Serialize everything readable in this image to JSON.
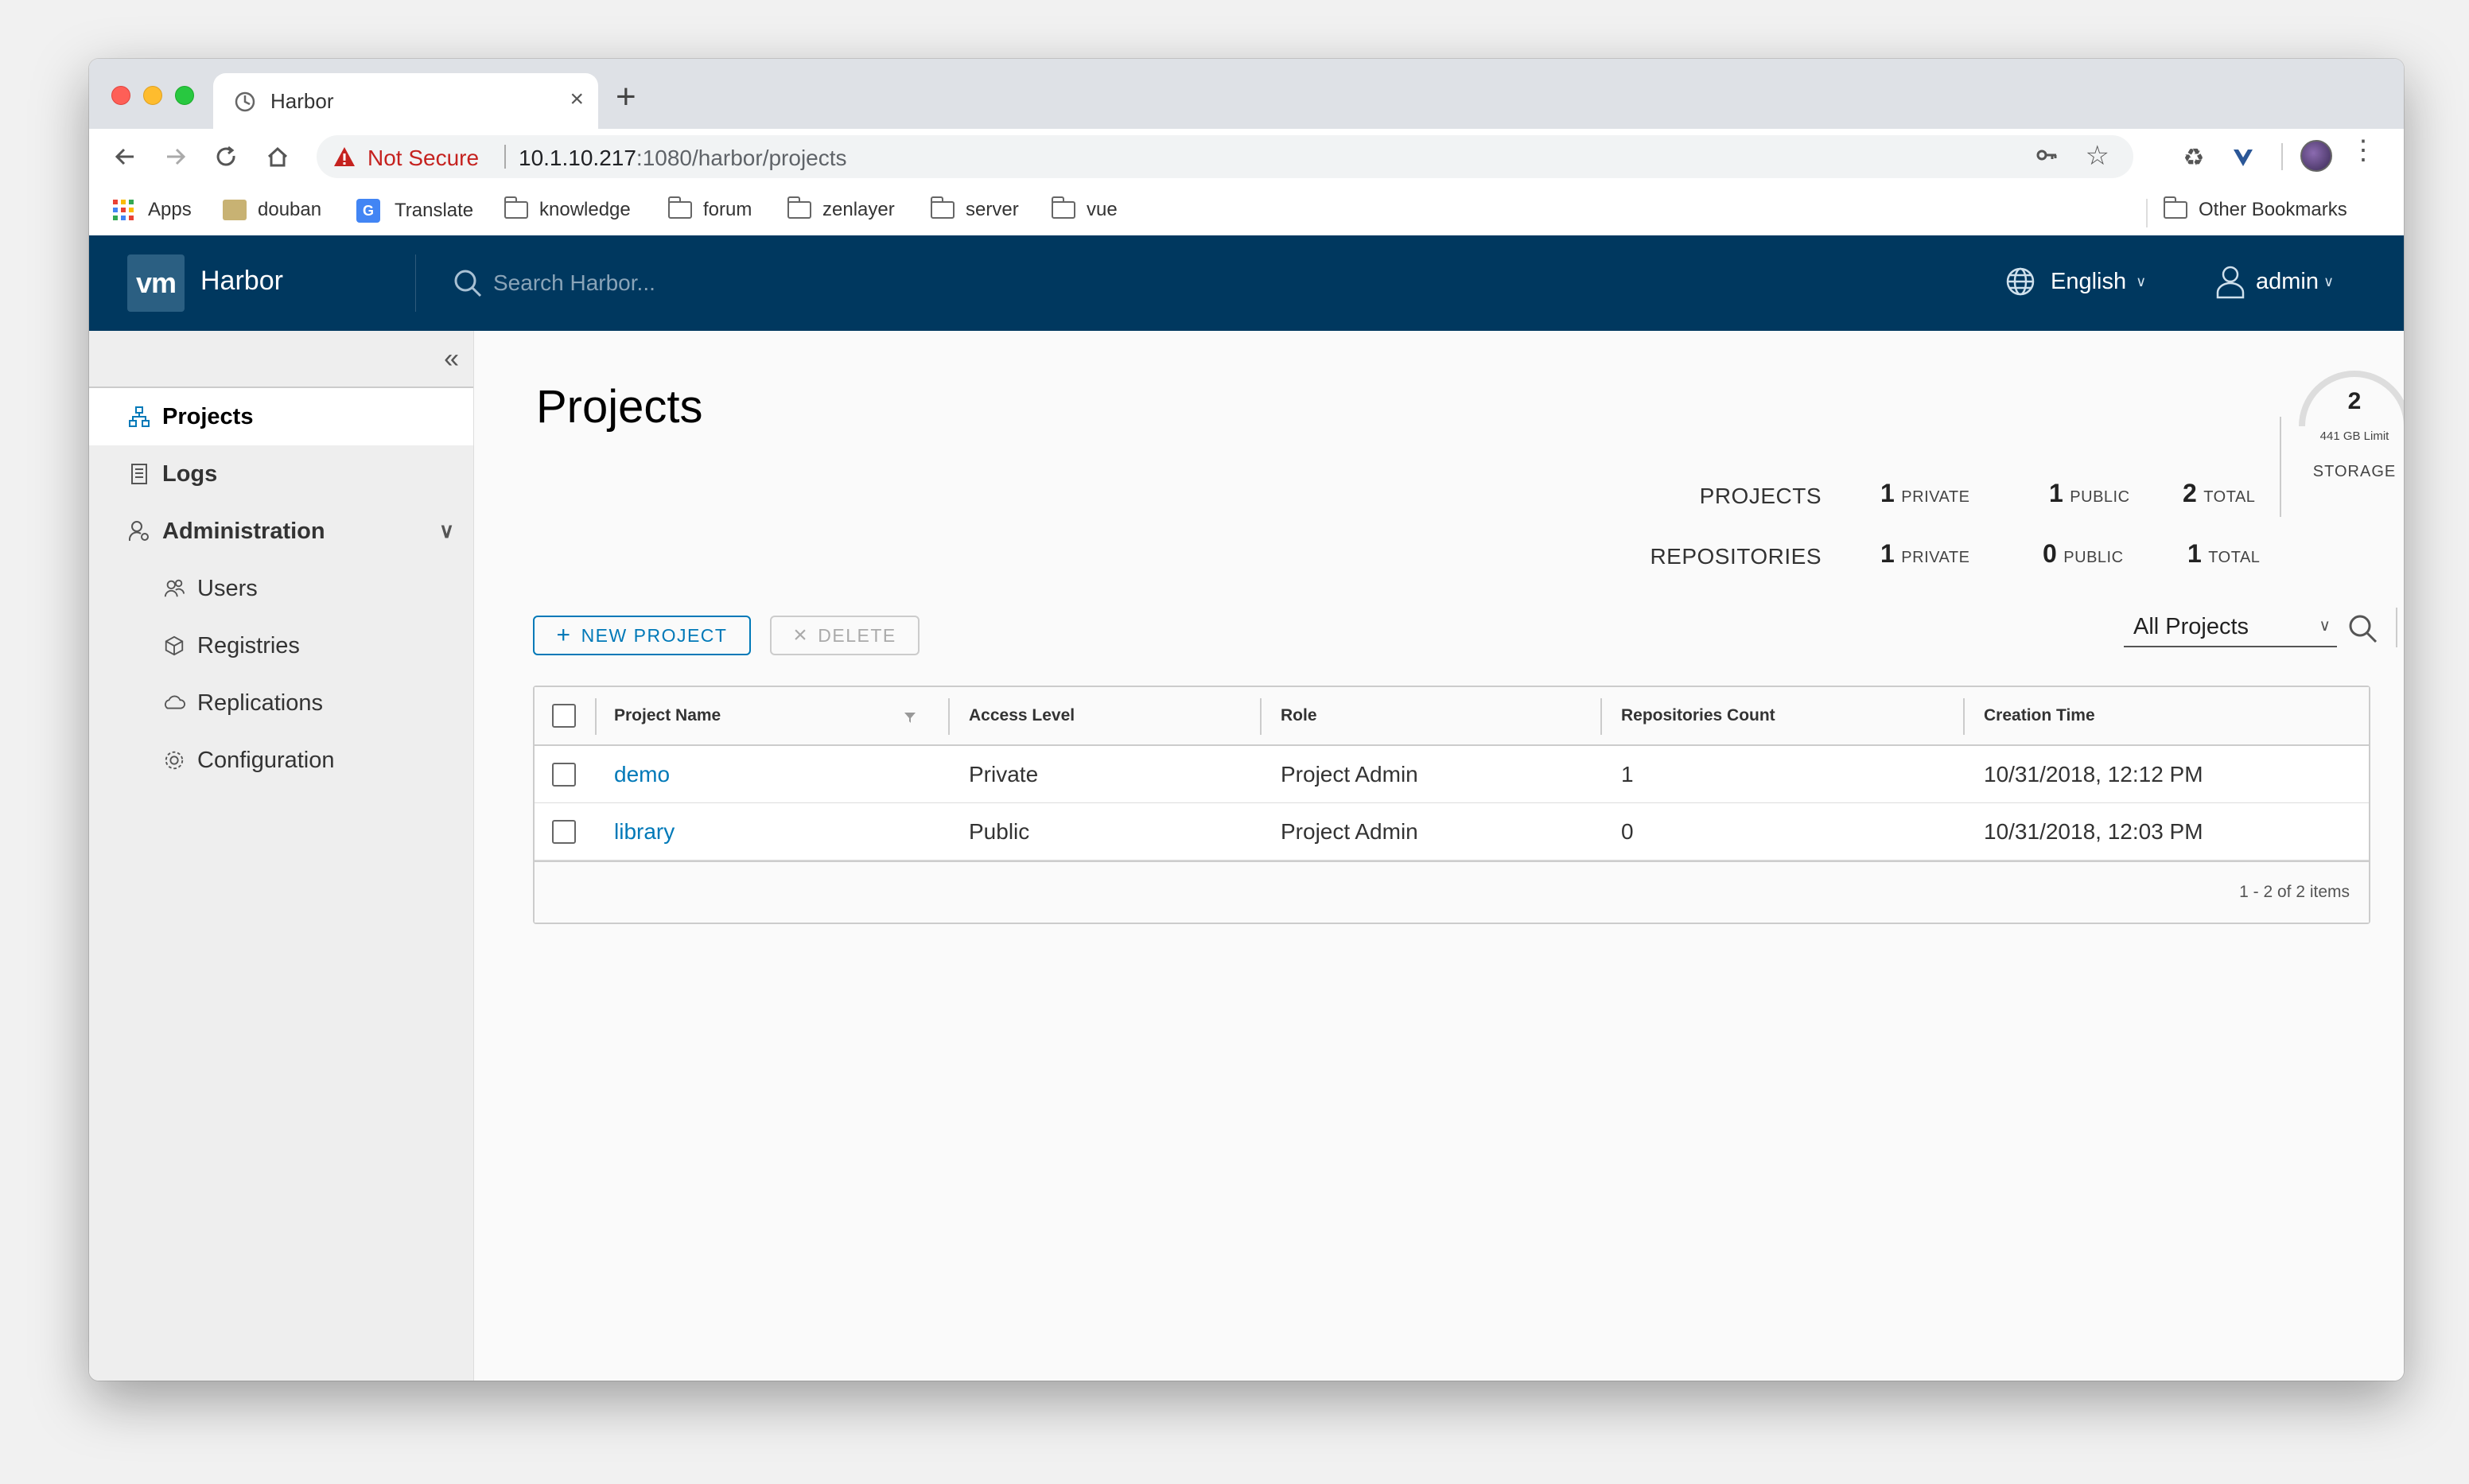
{
  "browser": {
    "tab_title": "Harbor",
    "security_label": "Not Secure",
    "url_host": "10.1.10.217",
    "url_path": ":1080/harbor/projects",
    "bookmarks": [
      "Apps",
      "douban",
      "Translate",
      "knowledge",
      "forum",
      "zenlayer",
      "server",
      "vue"
    ],
    "other_bookmarks": "Other Bookmarks"
  },
  "header": {
    "logo": "vm",
    "brand": "Harbor",
    "search_placeholder": "Search Harbor...",
    "language": "English",
    "user": "admin"
  },
  "sidebar": {
    "items": [
      {
        "label": "Projects",
        "icon": "projects-icon"
      },
      {
        "label": "Logs",
        "icon": "logs-icon"
      },
      {
        "label": "Administration",
        "icon": "administration-icon"
      },
      {
        "label": "Users",
        "icon": "users-icon"
      },
      {
        "label": "Registries",
        "icon": "registries-icon"
      },
      {
        "label": "Replications",
        "icon": "replications-icon"
      },
      {
        "label": "Configuration",
        "icon": "configuration-icon"
      }
    ]
  },
  "main": {
    "title": "Projects",
    "stats": {
      "projects_label": "PROJECTS",
      "repositories_label": "REPOSITORIES",
      "projects": {
        "private": "1",
        "public": "1",
        "total": "2"
      },
      "repositories": {
        "private": "1",
        "public": "0",
        "total": "1"
      },
      "private_label": "PRIVATE",
      "public_label": "PUBLIC",
      "total_label": "TOTAL",
      "storage_value": "2",
      "storage_limit": "441 GB Limit",
      "storage_label": "STORAGE"
    },
    "new_project_label": "NEW PROJECT",
    "delete_label": "DELETE",
    "filter_selected": "All Projects",
    "table": {
      "headers": [
        "Project Name",
        "Access Level",
        "Role",
        "Repositories Count",
        "Creation Time"
      ],
      "rows": [
        [
          "demo",
          "Private",
          "Project Admin",
          "1",
          "10/31/2018, 12:12 PM"
        ],
        [
          "library",
          "Public",
          "Project Admin",
          "0",
          "10/31/2018, 12:03 PM"
        ]
      ],
      "footer": "1 - 2 of 2 items"
    }
  },
  "colors": {
    "header_bg": "#00385f",
    "accent": "#0079b8",
    "not_secure": "#c5221f"
  }
}
